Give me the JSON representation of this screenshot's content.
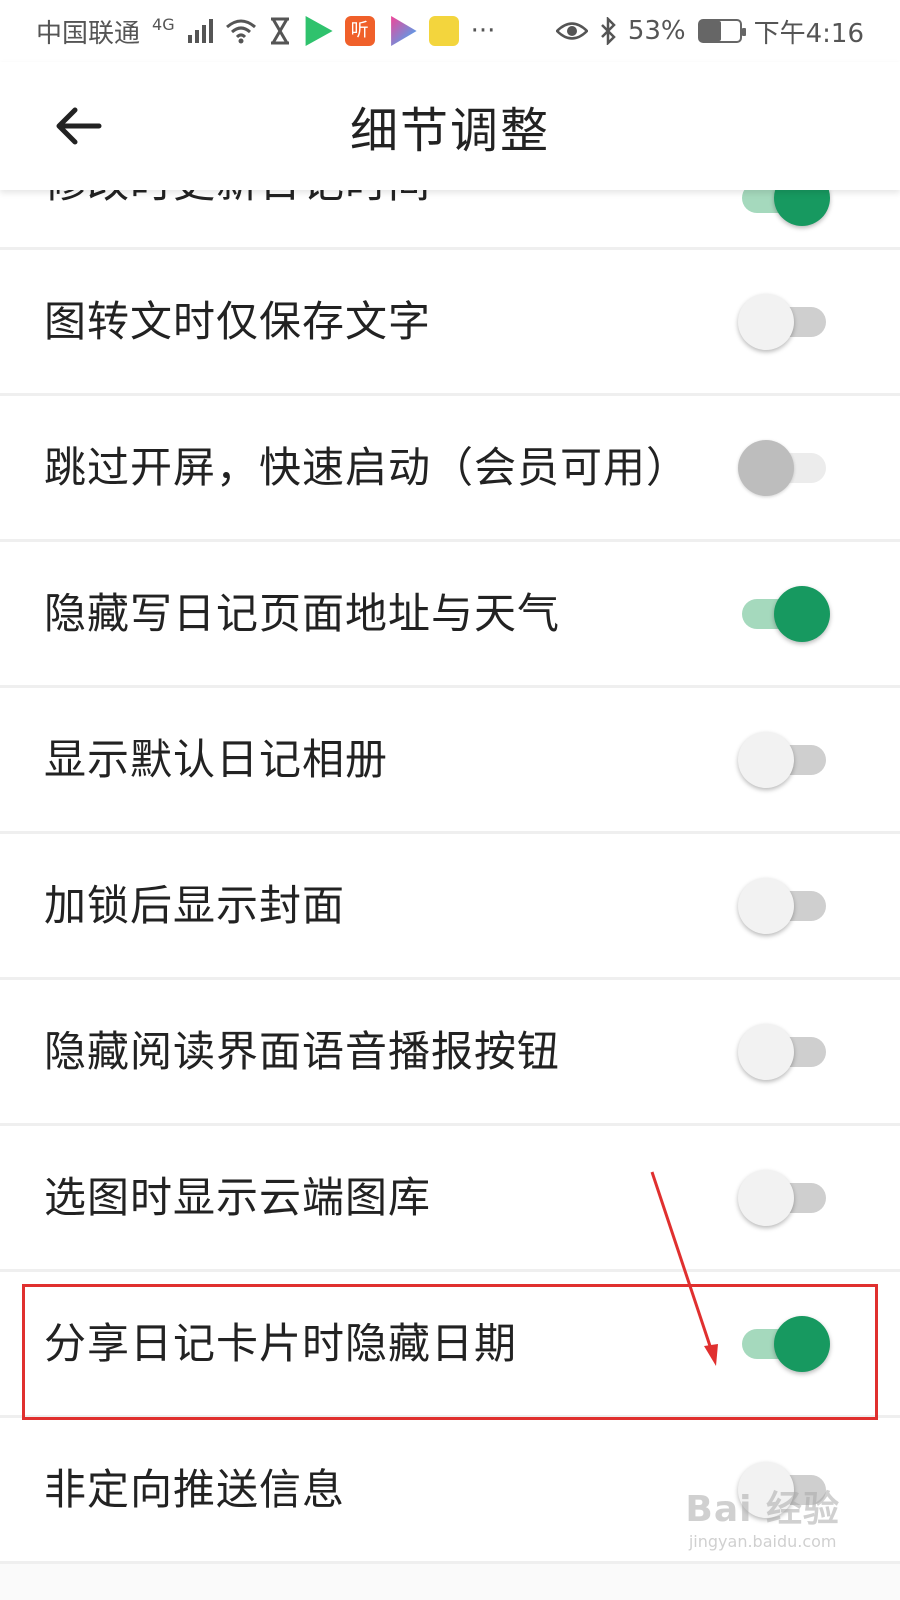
{
  "status_bar": {
    "carrier": "中国联通",
    "network": "4G",
    "battery": "53%",
    "battery_level": 0.53,
    "time": "下午4:16",
    "more": "···"
  },
  "header": {
    "title": "细节调整",
    "back_icon": "arrow-left-icon"
  },
  "settings": {
    "partial_label": "修改时更新日记时间",
    "partial_on": true,
    "items": [
      {
        "label": "图转文时仅保存文字",
        "on": false,
        "disabled": false
      },
      {
        "label": "跳过开屏，快速启动（会员可用）",
        "on": false,
        "disabled": true
      },
      {
        "label": "隐藏写日记页面地址与天气",
        "on": true,
        "disabled": false
      },
      {
        "label": "显示默认日记相册",
        "on": false,
        "disabled": false
      },
      {
        "label": "加锁后显示封面",
        "on": false,
        "disabled": false
      },
      {
        "label": "隐藏阅读界面语音播报按钮",
        "on": false,
        "disabled": false
      },
      {
        "label": "选图时显示云端图库",
        "on": false,
        "disabled": false
      },
      {
        "label": "分享日记卡片时隐藏日期",
        "on": true,
        "disabled": false
      },
      {
        "label": "非定向推送信息",
        "on": false,
        "disabled": false
      }
    ]
  },
  "colors": {
    "accent": "#179960",
    "accent_track": "#a5d9bd",
    "annotation": "#e0302f"
  },
  "watermark": {
    "logo": "Bai 经验",
    "url": "jingyan.baidu.com"
  }
}
